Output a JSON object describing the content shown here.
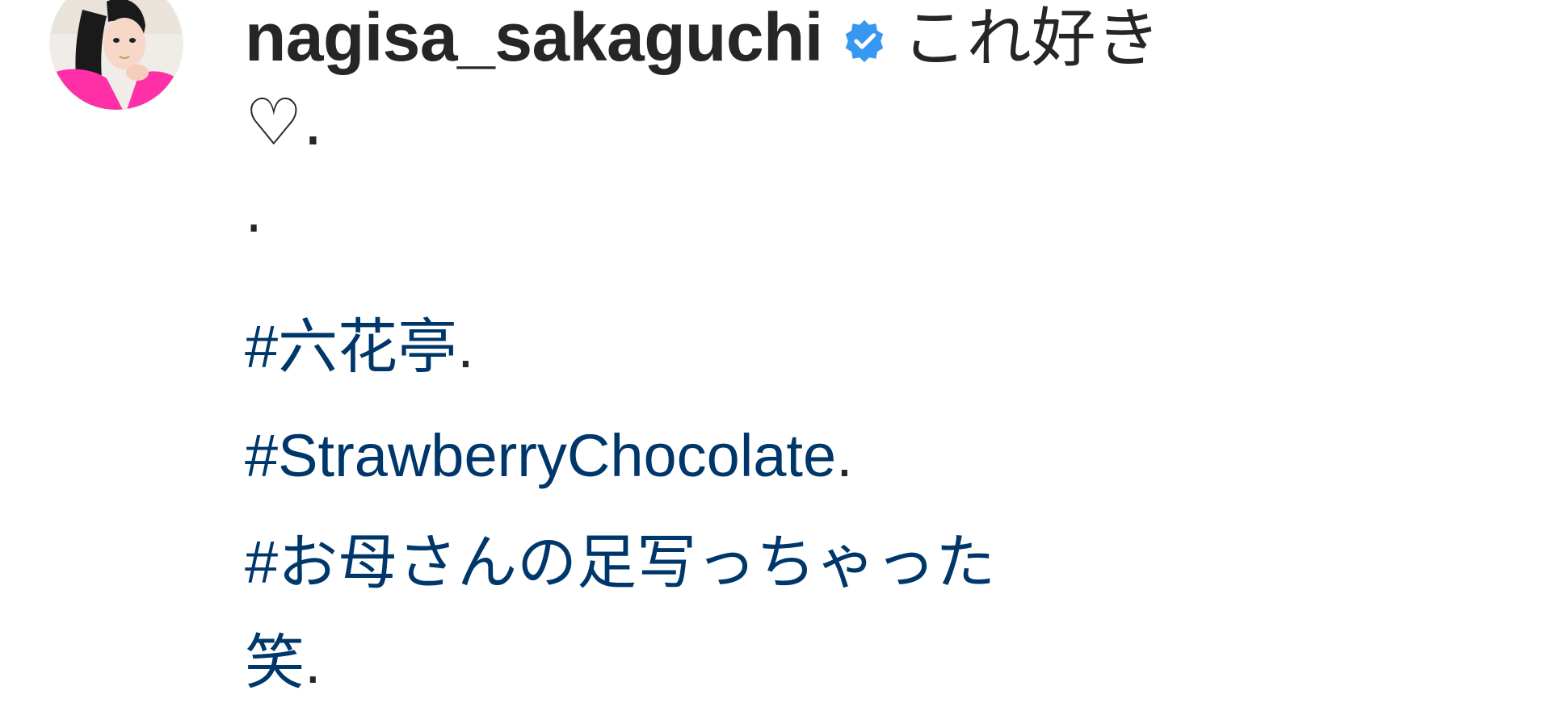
{
  "post": {
    "username": "nagisa_sakaguchi",
    "verified_icon": "verified-badge-icon",
    "caption_first": "これ好き",
    "caption_heart": "♡.",
    "caption_dot": ".",
    "hashtags": [
      {
        "text": "#六花亭",
        "suffix": "."
      },
      {
        "text": "#StrawberryChocolate",
        "suffix": "."
      },
      {
        "text": "#お母さんの足写っちゃった",
        "suffix": ""
      },
      {
        "text": "笑",
        "suffix": "."
      }
    ]
  },
  "colors": {
    "text": "#262626",
    "hashtag": "#00376b",
    "verified": "#3897f0"
  }
}
